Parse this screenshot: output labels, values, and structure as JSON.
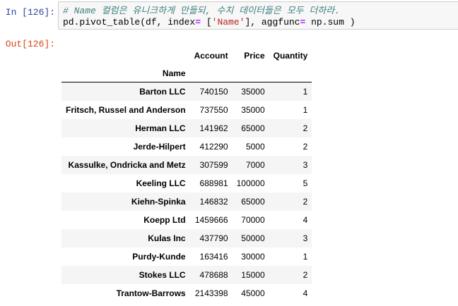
{
  "input_cell": {
    "prompt": "In [126]:",
    "comment": "# Name 컬럼은 유니크하게 만들되, 수치 데이터들은 모두 더하라.",
    "code_parts": {
      "p1": "pd.pivot_table(df, index",
      "eq": "=",
      "p2": " [",
      "str": "'Name'",
      "p3": "], aggfunc",
      "eq2": "=",
      "p4": " np.sum )"
    }
  },
  "output_cell": {
    "prompt": "Out[126]:"
  },
  "table": {
    "columns": [
      "Account",
      "Price",
      "Quantity"
    ],
    "index_name": "Name",
    "rows": [
      {
        "name": "Barton LLC",
        "account": "740150",
        "price": "35000",
        "quantity": "1"
      },
      {
        "name": "Fritsch, Russel and Anderson",
        "account": "737550",
        "price": "35000",
        "quantity": "1"
      },
      {
        "name": "Herman LLC",
        "account": "141962",
        "price": "65000",
        "quantity": "2"
      },
      {
        "name": "Jerde-Hilpert",
        "account": "412290",
        "price": "5000",
        "quantity": "2"
      },
      {
        "name": "Kassulke, Ondricka and Metz",
        "account": "307599",
        "price": "7000",
        "quantity": "3"
      },
      {
        "name": "Keeling LLC",
        "account": "688981",
        "price": "100000",
        "quantity": "5"
      },
      {
        "name": "Kiehn-Spinka",
        "account": "146832",
        "price": "65000",
        "quantity": "2"
      },
      {
        "name": "Koepp Ltd",
        "account": "1459666",
        "price": "70000",
        "quantity": "4"
      },
      {
        "name": "Kulas Inc",
        "account": "437790",
        "price": "50000",
        "quantity": "3"
      },
      {
        "name": "Purdy-Kunde",
        "account": "163416",
        "price": "30000",
        "quantity": "1"
      },
      {
        "name": "Stokes LLC",
        "account": "478688",
        "price": "15000",
        "quantity": "2"
      },
      {
        "name": "Trantow-Barrows",
        "account": "2143398",
        "price": "45000",
        "quantity": "4"
      }
    ]
  },
  "colors": {
    "in_prompt": "#303f9f",
    "out_prompt": "#d84315",
    "comment": "#408080",
    "string": "#ba2121",
    "operator": "#aa22ff"
  }
}
